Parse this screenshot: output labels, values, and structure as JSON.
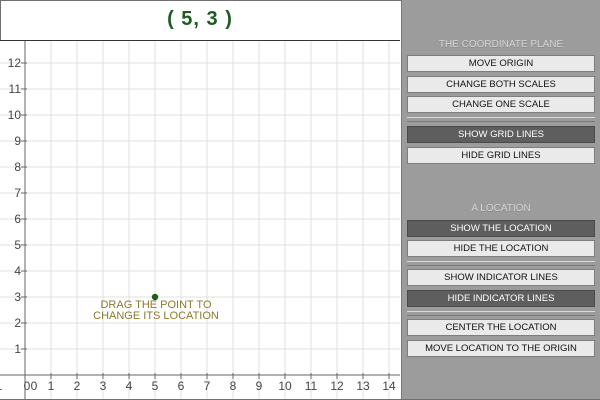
{
  "coordinate_display": "( 5, 3 )",
  "point": {
    "x": 5,
    "y": 3
  },
  "hint": {
    "line1": "DRAG THE POINT TO",
    "line2": "CHANGE ITS LOCATION"
  },
  "grid": {
    "x_min": -1,
    "x_max": 14,
    "y_min": 0,
    "y_max": 12,
    "x_ticks": [
      "1",
      "0",
      "1",
      "2",
      "3",
      "4",
      "5",
      "6",
      "7",
      "8",
      "9",
      "10",
      "11",
      "12",
      "13",
      "14"
    ],
    "y_ticks": [
      "1",
      "2",
      "3",
      "4",
      "5",
      "6",
      "7",
      "8",
      "9",
      "10",
      "11",
      "12"
    ],
    "origin_label": "0",
    "grid_visible": true
  },
  "colors": {
    "point": "#1f5c1f",
    "hint": "#8b7a2e",
    "coord_text": "#1c5c1c",
    "panel_bg": "#9c9c9c",
    "grid": "#e0e0e0"
  },
  "panel": {
    "plane_title": "THE COORDINATE PLANE",
    "move_origin": "MOVE ORIGIN",
    "change_both_scales": "CHANGE BOTH SCALES",
    "change_one_scale": "CHANGE ONE SCALE",
    "show_grid_lines": "SHOW GRID LINES",
    "hide_grid_lines": "HIDE GRID LINES",
    "location_title": "A LOCATION",
    "show_location": "SHOW THE LOCATION",
    "hide_location": "HIDE THE LOCATION",
    "show_indicator_lines": "SHOW INDICATOR LINES",
    "hide_indicator_lines": "HIDE INDICATOR LINES",
    "center_location": "CENTER THE LOCATION",
    "move_location_origin": "MOVE LOCATION TO THE ORIGIN"
  },
  "active_buttons": [
    "show_grid_lines",
    "show_location",
    "hide_indicator_lines"
  ]
}
